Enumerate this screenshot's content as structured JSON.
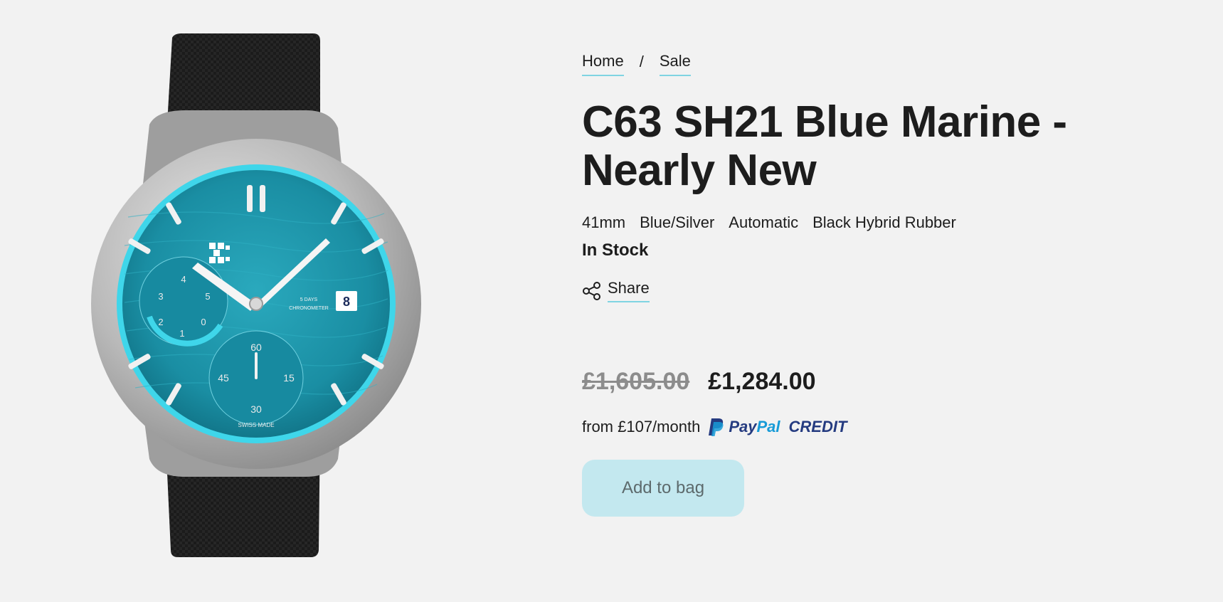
{
  "breadcrumb": {
    "home": "Home",
    "separator": "/",
    "sale": "Sale"
  },
  "product": {
    "title_line1": "C63 SH21 Blue Marine -",
    "title_line2": "Nearly New",
    "specs": [
      "41mm",
      "Blue/Silver",
      "Automatic",
      "Black Hybrid Rubber"
    ],
    "stock": "In Stock"
  },
  "share": {
    "label": "Share",
    "icon": "share-icon"
  },
  "price": {
    "old": "£1,605.00",
    "current": "£1,284.00"
  },
  "finance": {
    "text": "from £107/month",
    "paypal_pay": "Pay",
    "paypal_pal": "Pal",
    "paypal_credit": "CREDIT"
  },
  "cta": {
    "add_to_bag": "Add to bag"
  },
  "watch_dial": {
    "brand_mark": "✠",
    "line1": "5 DAYS",
    "line2": "CHRONOMETER",
    "date": "8",
    "bottom_text": "SWISS MADE",
    "subdial_right": [
      "60",
      "15",
      "30",
      "45"
    ],
    "subdial_left": [
      "4",
      "5",
      "3",
      "2",
      "1",
      "0"
    ]
  },
  "colors": {
    "accent_underline": "#7fd4e2",
    "button_bg": "#c3e8ef",
    "dial": "#1e95a8",
    "paypal_dark": "#253b80",
    "paypal_light": "#179bd7"
  }
}
